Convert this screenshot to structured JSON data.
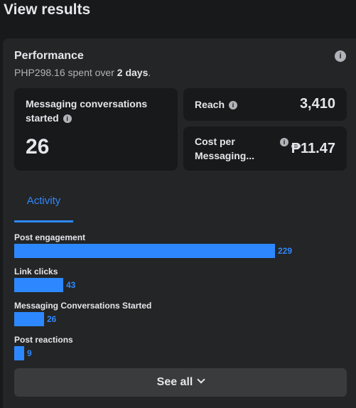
{
  "page": {
    "title": "View results"
  },
  "performance": {
    "title": "Performance",
    "spent_amount": "PHP298.16",
    "spent_mid": " spent over ",
    "spent_days": "2 days",
    "spent_end": ".",
    "info_icon": "info-icon"
  },
  "cards": {
    "messaging": {
      "label": "Messaging conversations started",
      "value": "26"
    },
    "reach": {
      "label": "Reach",
      "value": "3,410"
    },
    "cost": {
      "label_line1": "Cost per",
      "label_line2": "Messaging...",
      "value": "₱11.47"
    }
  },
  "tabs": {
    "activity": "Activity"
  },
  "activity_max": 229,
  "activity": [
    {
      "label": "Post engagement",
      "value": 229
    },
    {
      "label": "Link clicks",
      "value": 43
    },
    {
      "label": "Messaging Conversations Started",
      "value": 26
    },
    {
      "label": "Post reactions",
      "value": 9
    }
  ],
  "footer": {
    "see_all_label": "See all"
  },
  "colors": {
    "accent": "#2d88ff",
    "background": "#18191a",
    "panel": "#242526"
  }
}
